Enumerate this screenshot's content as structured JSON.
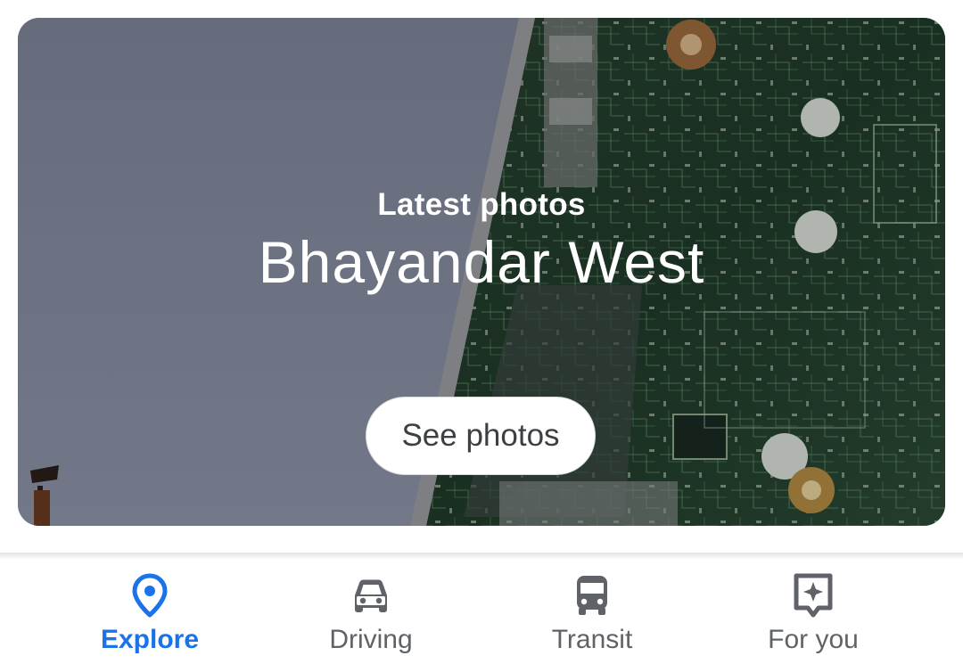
{
  "card": {
    "subtitle": "Latest photos",
    "title": "Bhayandar West",
    "button_label": "See photos"
  },
  "nav": {
    "items": [
      {
        "label": "Explore",
        "icon": "location-pin-icon",
        "active": true
      },
      {
        "label": "Driving",
        "icon": "car-icon",
        "active": false
      },
      {
        "label": "Transit",
        "icon": "bus-icon",
        "active": false
      },
      {
        "label": "For you",
        "icon": "sparkle-post-icon",
        "active": false
      }
    ]
  },
  "colors": {
    "accent": "#1a73e8",
    "inactive": "#5f6368",
    "sky": "#7b8296",
    "board": "#1f3a2c"
  }
}
